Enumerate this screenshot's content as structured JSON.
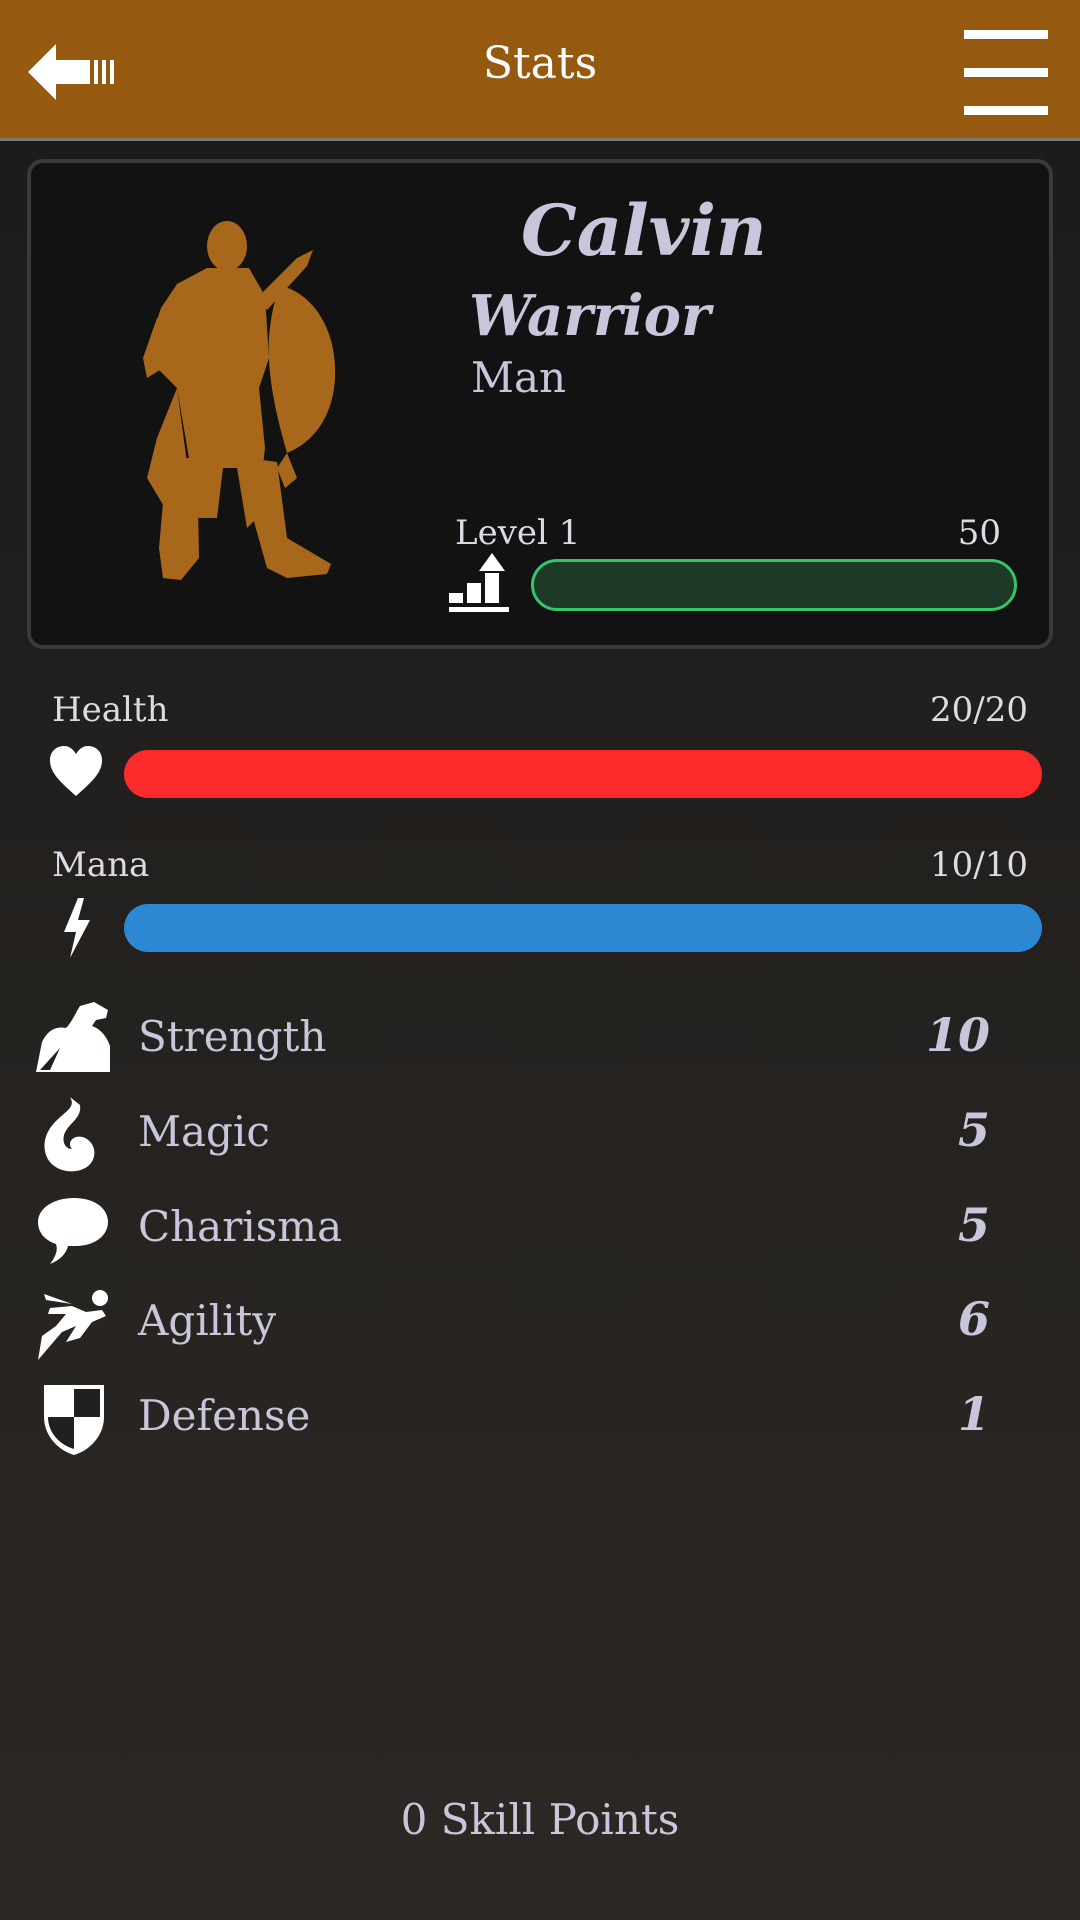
{
  "header": {
    "title": "Stats",
    "accent": "#955910"
  },
  "character": {
    "name": "Calvin",
    "class": "Warrior",
    "race": "Man",
    "level_label": "Level 1",
    "xp_value": "50",
    "xp_fraction": 0,
    "portrait_color": "#a8681b"
  },
  "vitals": {
    "health": {
      "label": "Health",
      "value": "20/20",
      "fraction": 1.0,
      "color": "#fb2b2b",
      "icon": "heart-icon"
    },
    "mana": {
      "label": "Mana",
      "value": "10/10",
      "fraction": 1.0,
      "color": "#2d88d4",
      "icon": "lightning-icon"
    }
  },
  "attributes": [
    {
      "label": "Strength",
      "value": "10",
      "icon": "flexed-arm-icon"
    },
    {
      "label": "Magic",
      "value": "5",
      "icon": "flame-icon"
    },
    {
      "label": "Charisma",
      "value": "5",
      "icon": "speech-bubble-icon"
    },
    {
      "label": "Agility",
      "value": "6",
      "icon": "running-figure-icon"
    },
    {
      "label": "Defense",
      "value": "1",
      "icon": "checkered-shield-icon"
    }
  ],
  "footer": {
    "skill_points": "0 Skill Points"
  }
}
